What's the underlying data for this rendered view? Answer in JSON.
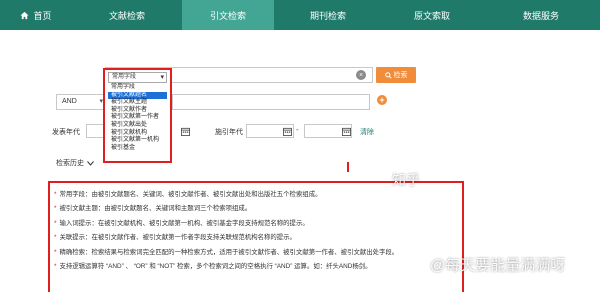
{
  "nav": {
    "home": "首页",
    "items": [
      "文献检索",
      "引文检索",
      "期刊检索",
      "原文索取",
      "数据服务"
    ]
  },
  "search": {
    "button": "检索",
    "clear": "×",
    "logic": "AND",
    "add": "+"
  },
  "dropdown": {
    "selected": "常用字段",
    "options": [
      "常用字段",
      "被引文献题名",
      "被引文献主题",
      "被引文献作者",
      "被引文献第一作者",
      "被引文献出处",
      "被引文献机构",
      "被引文献第一机构",
      "被引基金"
    ]
  },
  "filters": {
    "pub_year": "发表年代",
    "cite_year": "施引年代",
    "dash": "-",
    "reset": "清除"
  },
  "history": {
    "label": "检索历史"
  },
  "tips": [
    "常用字段：由被引文献题名、关键词、被引文献作者、被引文献出处和出版社五个检索组成。",
    "被引文献主题：由被引文献题名、关键词和主题词三个检索项组成。",
    "输入词提示：在被引文献机构、被引文献第一机构、被引基金字段支持规范名称的提示。",
    "关联提示：在被引文献作者、被引文献第一作者字段支持关联规范机构名称的提示。",
    "精确检索：检索结果与检索词完全匹配的一种检索方式，适用于被引文献作者、被引文献第一作者、被引文献出处字段。",
    "支持逻辑运算符 “AND” 、 “OR” 和 “NOT” 检索，多个检索词之间的空格执行 “AND” 运算。如：纤头AND杨剑。"
  ],
  "watermark": [
    "知乎",
    "@每天要能量满满呀"
  ],
  "colors": {
    "nav": "#1f7a6a",
    "nav_active": "#43a594",
    "accent": "#f08c3a",
    "highlight": "#e01e1e",
    "selected": "#1e6fd6"
  }
}
